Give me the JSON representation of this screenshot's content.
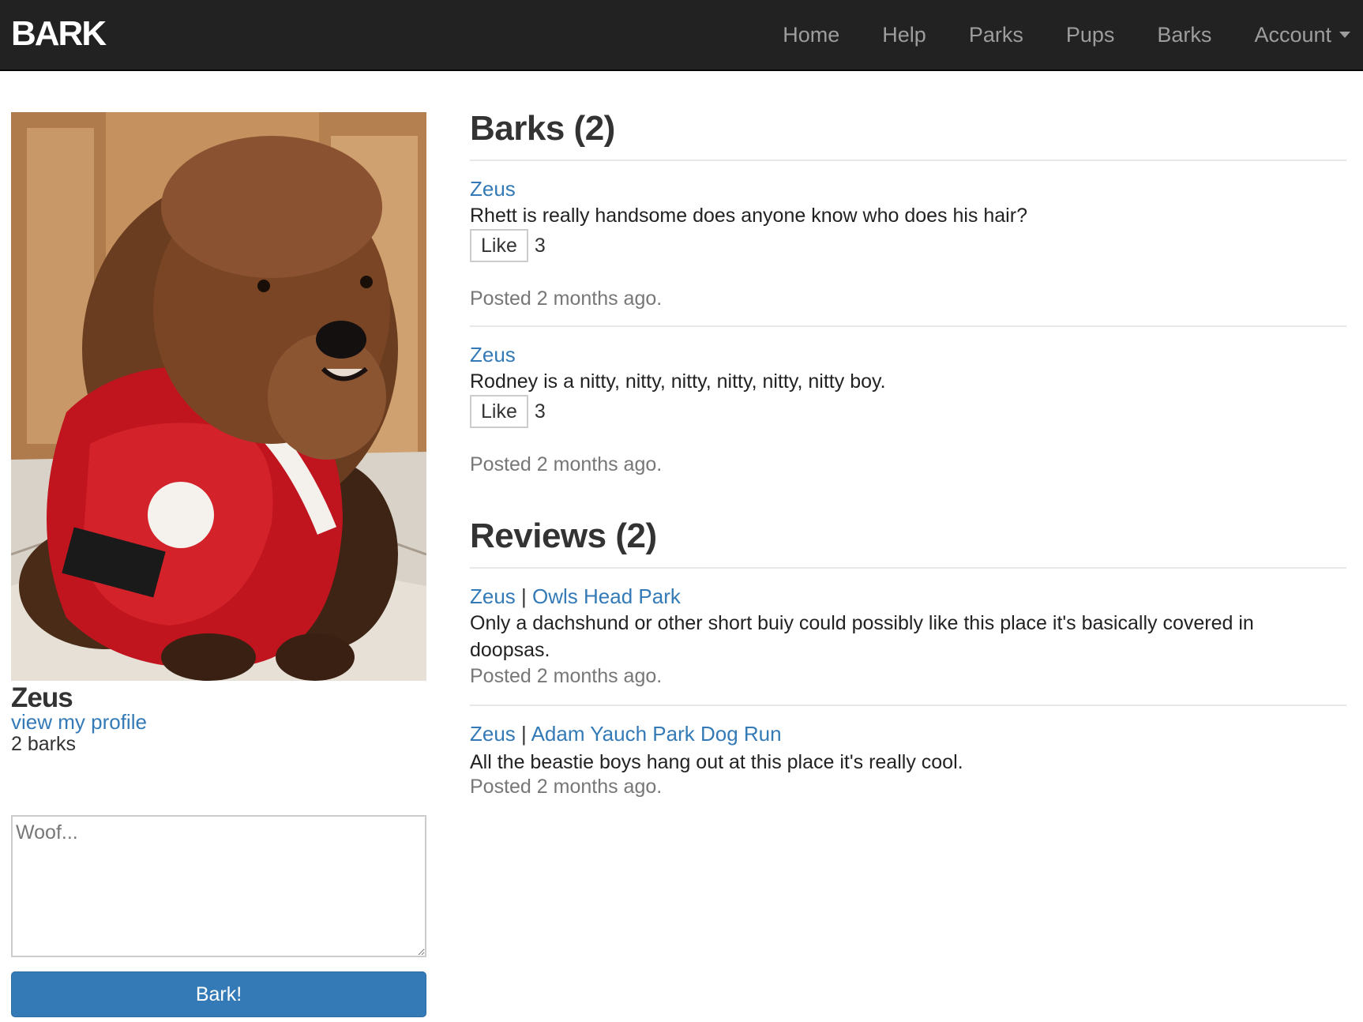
{
  "navbar": {
    "brand": "BARK",
    "items": [
      {
        "label": "Home"
      },
      {
        "label": "Help"
      },
      {
        "label": "Parks"
      },
      {
        "label": "Pups"
      },
      {
        "label": "Barks"
      },
      {
        "label": "Account"
      }
    ]
  },
  "sidebar": {
    "pup_name": "Zeus",
    "profile_link": "view my profile",
    "bark_count": "2 barks",
    "textarea_placeholder": "Woof...",
    "submit_label": "Bark!"
  },
  "barks": {
    "title": "Barks (2)",
    "items": [
      {
        "author": "Zeus",
        "text": "Rhett is really handsome does anyone know who does his hair?",
        "like_label": "Like",
        "likes": "3",
        "posted": "Posted 2 months ago."
      },
      {
        "author": "Zeus",
        "text": "Rodney is a nitty, nitty, nitty, nitty, nitty, nitty boy.",
        "like_label": "Like",
        "likes": "3",
        "posted": "Posted 2 months ago."
      }
    ]
  },
  "reviews": {
    "title": "Reviews (2)",
    "items": [
      {
        "author": "Zeus",
        "separator": "|",
        "park": "Owls Head Park",
        "text": "Only a dachshund or other short buiy could possibly like this place it's basically covered in doopsas.",
        "posted": "Posted 2 months ago."
      },
      {
        "author": "Zeus",
        "separator": "|",
        "park": "Adam Yauch Park Dog Run",
        "text": "All the beastie boys hang out at this place it's really cool.",
        "posted": "Posted 2 months ago."
      }
    ]
  },
  "colors": {
    "navbar_bg": "#222222",
    "link": "#337ab7",
    "button_primary": "#337ab7",
    "muted_text": "#777777"
  }
}
